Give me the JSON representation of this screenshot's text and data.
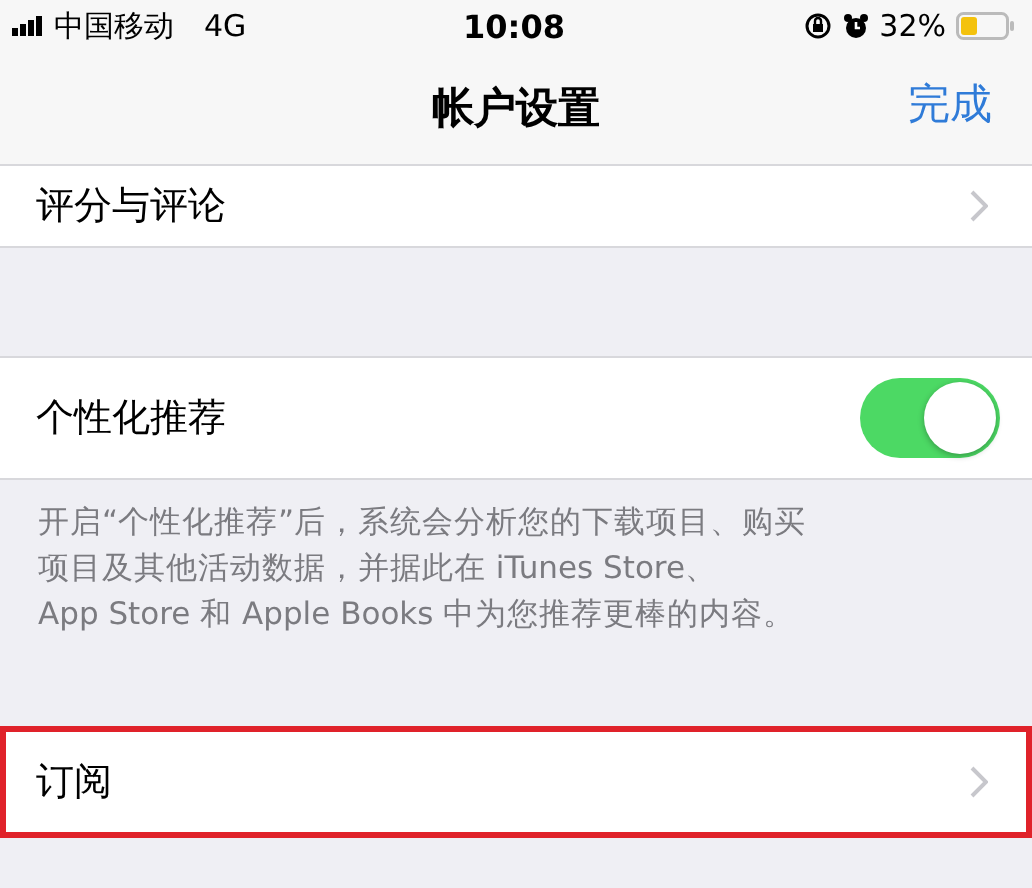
{
  "status_bar": {
    "carrier": "中国移动",
    "network": "4G",
    "time": "10:08",
    "battery": "32%"
  },
  "nav_bar": {
    "title": "帐户设置",
    "done": "完成"
  },
  "rows_top": [
    {
      "label": "评分与评论",
      "kind": "link",
      "highlighted": false
    }
  ],
  "toggle_section": {
    "rows": [
      {
        "label": "个性化推荐",
        "kind": "toggle",
        "on": true
      }
    ],
    "footer_lines": [
      "开启“个性化推荐”后，系统会分析您的下载项目、购买",
      "项目及其他活动数据，并据此在 iTunes Store、",
      "App Store 和 Apple Books 中为您推荐更棒的内容。"
    ]
  },
  "rows_bottom": [
    {
      "label": "订阅",
      "kind": "link",
      "highlighted": true
    }
  ]
}
